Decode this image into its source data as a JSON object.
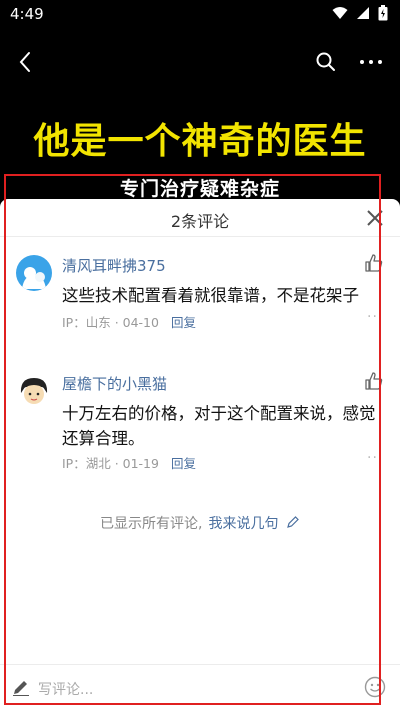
{
  "status_bar": {
    "time": "4:49",
    "icons": [
      "wifi-icon",
      "signal-icon",
      "battery-icon"
    ]
  },
  "nav": {
    "icons": [
      "back-icon",
      "search-icon",
      "more-icon"
    ]
  },
  "video": {
    "title": "他是一个神奇的医生",
    "subtitle": "专门治疗疑难杂症",
    "title_color": "#f2e400"
  },
  "comments_panel": {
    "title": "2条评论",
    "comments": [
      {
        "user": "清风耳畔拂375",
        "text": "这些技术配置看着就很靠谱，不是花架子",
        "meta": "IP：山东 · 04-10",
        "reply": "回复"
      },
      {
        "user": "屋檐下的小黑猫",
        "text": "十万左右的价格，对于这个配置来说，感觉还算合理。",
        "meta": "IP：湖北 · 01-19",
        "reply": "回复"
      }
    ],
    "end_text": "已显示所有评论,",
    "end_link": "我来说几句",
    "input_placeholder": "写评论..."
  },
  "colors": {
    "accent": "#4a6f9f",
    "highlight": "#e02020"
  }
}
